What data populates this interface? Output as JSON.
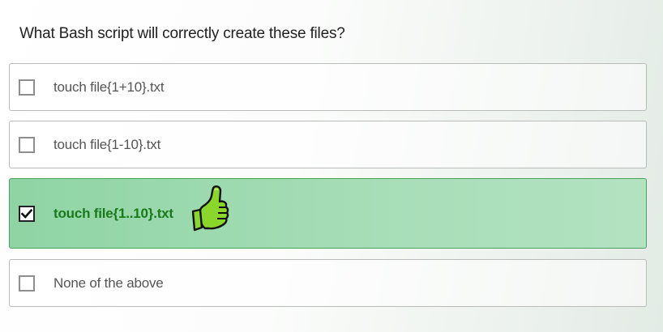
{
  "question": {
    "text": "What Bash script will correctly create these files?"
  },
  "options": [
    {
      "label": "touch file{1+10}.txt",
      "checked": false
    },
    {
      "label": "touch file{1-10}.txt",
      "checked": false
    },
    {
      "label": "touch file{1..10}.txt",
      "checked": true,
      "indicator": "thumbs-up-icon"
    },
    {
      "label": "None of the above",
      "checked": false
    }
  ],
  "colors": {
    "selected_background": "#a6ddb7",
    "selected_text": "#1a7a1a",
    "thumb_icon": "#8ad62a"
  }
}
